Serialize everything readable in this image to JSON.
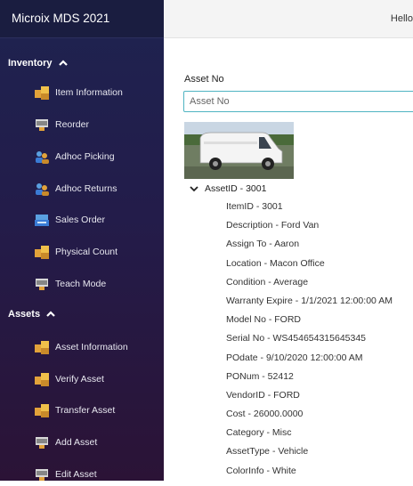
{
  "app": {
    "title": "Microix MDS 2021"
  },
  "header": {
    "greeting": "Hello"
  },
  "sidebar": {
    "sections": [
      {
        "label": "Inventory",
        "items": [
          {
            "label": "Item Information",
            "icon": "boxes-icon"
          },
          {
            "label": "Reorder",
            "icon": "barcode-scanner-icon"
          },
          {
            "label": "Adhoc Picking",
            "icon": "users-icon"
          },
          {
            "label": "Adhoc Returns",
            "icon": "users-icon"
          },
          {
            "label": "Sales Order",
            "icon": "cash-register-icon"
          },
          {
            "label": "Physical Count",
            "icon": "boxes-icon"
          },
          {
            "label": "Teach Mode",
            "icon": "barcode-scanner-icon"
          }
        ]
      },
      {
        "label": "Assets",
        "items": [
          {
            "label": "Asset Information",
            "icon": "boxes-icon"
          },
          {
            "label": "Verify Asset",
            "icon": "boxes-icon"
          },
          {
            "label": "Transfer Asset",
            "icon": "boxes-icon"
          },
          {
            "label": "Add Asset",
            "icon": "barcode-scanner-icon"
          },
          {
            "label": "Edit Asset",
            "icon": "barcode-scanner-icon"
          }
        ]
      }
    ]
  },
  "main": {
    "asset_no_label": "Asset No",
    "asset_no_placeholder": "Asset No",
    "asset_no_value": "",
    "asset_header": "AssetID - 3001",
    "details": [
      "ItemID - 3001",
      "Description - Ford Van",
      "Assign To - Aaron",
      "Location - Macon Office",
      "Condition - Average",
      "Warranty Expire - 1/1/2021 12:00:00 AM",
      "Model No - FORD",
      "Serial No - WS454654315645345",
      "POdate - 9/10/2020 12:00:00 AM",
      "PONum - 52412",
      "VendorID - FORD",
      "Cost - 26000.0000",
      "Category - Misc",
      "AssetType - Vehicle",
      "ColorInfo - White"
    ]
  },
  "colors": {
    "sidebar_top": "#1e2350",
    "sidebar_bottom": "#2b1336",
    "input_border": "#4fb4c2"
  }
}
